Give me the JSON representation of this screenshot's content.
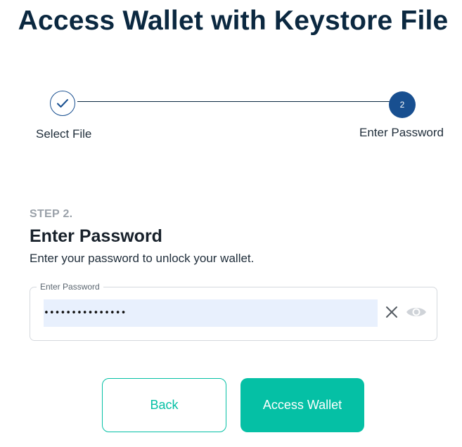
{
  "page": {
    "title": "Access Wallet with Keystore File"
  },
  "stepper": {
    "steps": [
      {
        "label": "Select File",
        "status": "complete",
        "icon": "checkmark-icon"
      },
      {
        "label": "Enter Password",
        "number": "2",
        "status": "active"
      }
    ]
  },
  "step_content": {
    "kicker": "STEP 2.",
    "heading": "Enter Password",
    "description": "Enter your password to unlock your wallet."
  },
  "password_field": {
    "label": "Enter Password",
    "value": "•••••••••••••••",
    "clear_icon": "close-icon",
    "visibility_icon": "eye-icon"
  },
  "buttons": {
    "back_label": "Back",
    "access_label": "Access Wallet"
  },
  "colors": {
    "primary_dark": "#0b2840",
    "step_blue": "#184f90",
    "accent_teal": "#05c0a5",
    "input_fill": "#e8f0fd"
  }
}
